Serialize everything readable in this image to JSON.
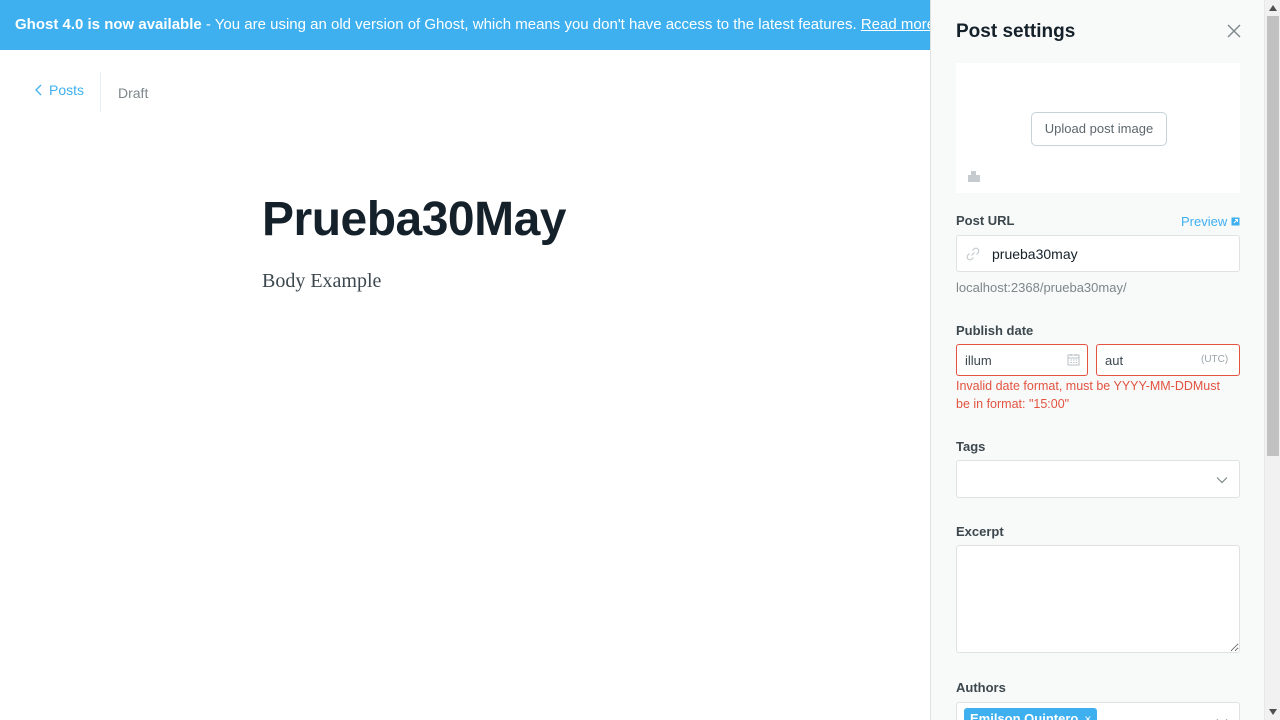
{
  "banner": {
    "bold": "Ghost 4.0 is now available",
    "text": " - You are using an old version of Ghost, which means you don't have access to the latest features. ",
    "link": "Read more!"
  },
  "nav": {
    "back_label": "Posts",
    "status": "Draft"
  },
  "post": {
    "title": "Prueba30May",
    "body": "Body Example"
  },
  "settings": {
    "title": "Post settings",
    "upload_label": "Upload post image",
    "post_url_label": "Post URL",
    "preview_label": "Preview",
    "url_value": "prueba30may",
    "url_hint": "localhost:2368/prueba30may/",
    "publish_date_label": "Publish date",
    "date_value": "illum",
    "time_value": "aut",
    "utc_label": "(UTC)",
    "date_error": "Invalid date format, must be YYYY-MM-DDMust be in format: \"15:00\"",
    "tags_label": "Tags",
    "excerpt_label": "Excerpt",
    "excerpt_value": "",
    "authors_label": "Authors",
    "author_name": "Emilson Quintero",
    "author_remove": "×"
  },
  "colors": {
    "accent": "#3eb0ef",
    "error": "#e25440"
  }
}
